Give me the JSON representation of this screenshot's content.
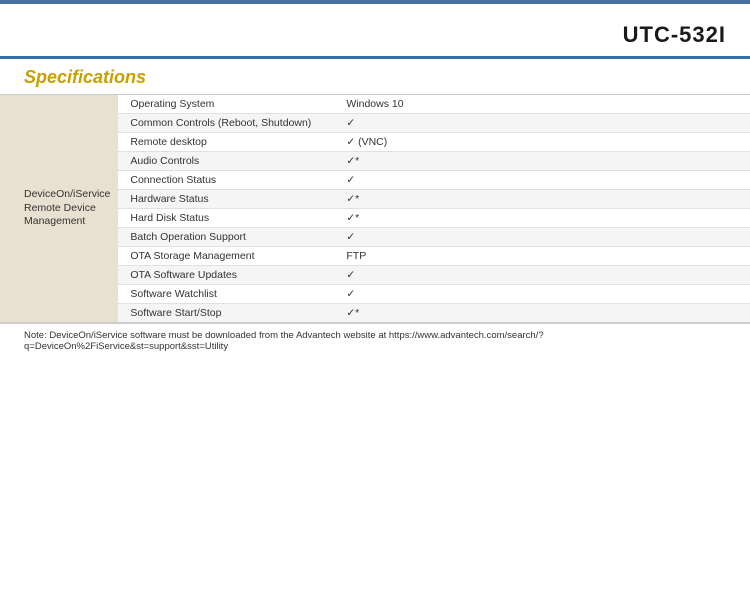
{
  "header": {
    "product_title": "UTC-532I",
    "specs_heading": "Specifications"
  },
  "table": {
    "category": {
      "line1": "DeviceOn/iService",
      "line2": "Remote Device Management"
    },
    "rows": [
      {
        "feature": "Operating System",
        "value": "Windows 10",
        "shaded": false
      },
      {
        "feature": "Common Controls (Reboot, Shutdown)",
        "value": "✓",
        "shaded": true
      },
      {
        "feature": "Remote desktop",
        "value": "✓ (VNC)",
        "shaded": false
      },
      {
        "feature": "Audio Controls",
        "value": "✓*",
        "shaded": true
      },
      {
        "feature": "Connection Status",
        "value": "✓",
        "shaded": false
      },
      {
        "feature": "Hardware Status",
        "value": "✓*",
        "shaded": true
      },
      {
        "feature": "Hard Disk Status",
        "value": "✓*",
        "shaded": false
      },
      {
        "feature": "Batch Operation Support",
        "value": "✓",
        "shaded": true
      },
      {
        "feature": "OTA Storage Management",
        "value": "FTP",
        "shaded": false
      },
      {
        "feature": "OTA Software Updates",
        "value": "✓",
        "shaded": true
      },
      {
        "feature": "Software Watchlist",
        "value": "✓",
        "shaded": false
      },
      {
        "feature": "Software Start/Stop",
        "value": "✓*",
        "shaded": true
      }
    ]
  },
  "note": {
    "text": "Note: DeviceOn/iService software must be downloaded from the Advantech website at https://www.advantech.com/search/?q=DeviceOn%2FiService&st=support&sst=Utility"
  }
}
